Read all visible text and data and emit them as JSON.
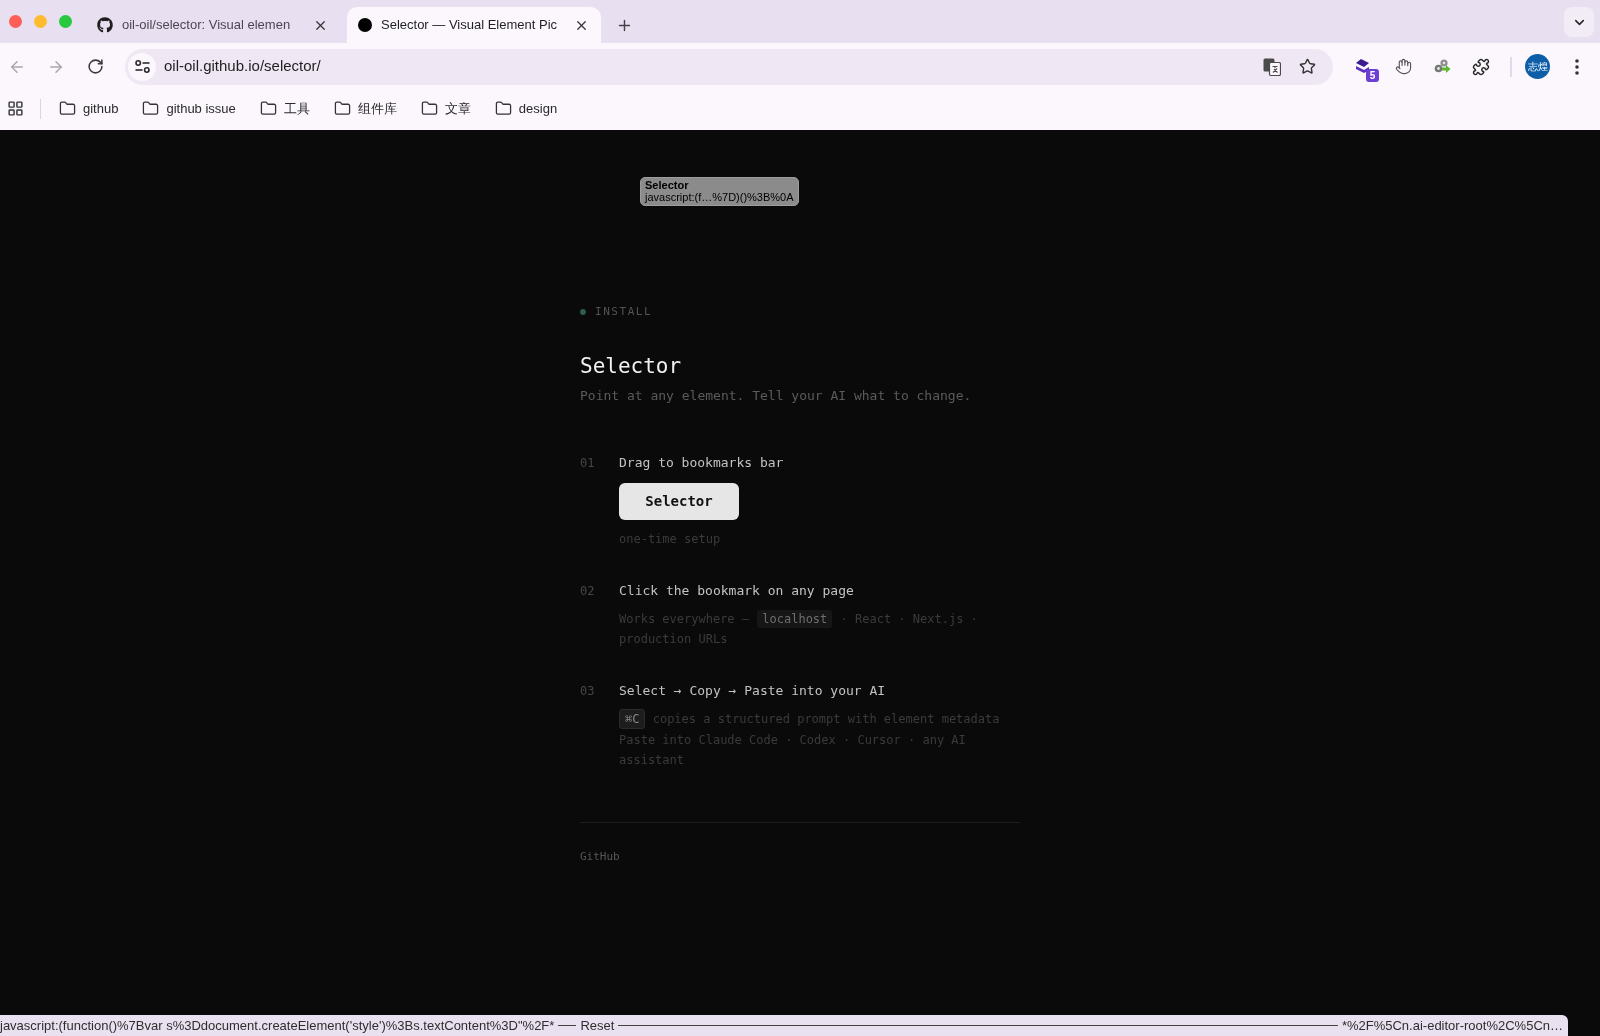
{
  "browser": {
    "tabs": [
      {
        "title": "oil-oil/selector: Visual elemen",
        "selected": false
      },
      {
        "title": "Selector — Visual Element Pic",
        "selected": true
      }
    ],
    "navigation": [
      {
        "disabled": true
      },
      {
        "disabled": true
      },
      {
        "disabled": false
      }
    ],
    "address": "oil-oil.github.io/selector/",
    "extension_badge": "5",
    "profile": "志煌",
    "bookmarks": [
      {
        "label": "github"
      },
      {
        "label": "github issue"
      },
      {
        "label": "工具"
      },
      {
        "label": "组件库"
      },
      {
        "label": "文章"
      },
      {
        "label": "design"
      }
    ]
  },
  "tooltip": {
    "title": "Selector",
    "url": "javascript:(f…%7D)()%3B%0A"
  },
  "page": {
    "eyebrow": "INSTALL",
    "title": "Selector",
    "subtitle": "Point at any element. Tell your AI what to change.",
    "steps": [
      {
        "number": "01",
        "title": "Drag to bookmarks bar",
        "blocks": [
          {
            "kind": "button",
            "label": "Selector"
          },
          {
            "kind": "note",
            "segments": [
              {
                "kind": "text",
                "text": "one-time setup"
              }
            ]
          }
        ]
      },
      {
        "number": "02",
        "title": "Click the bookmark on any page",
        "blocks": [
          {
            "kind": "note",
            "segments": [
              {
                "kind": "text",
                "text": "Works everywhere — "
              },
              {
                "kind": "code",
                "text": "localhost"
              },
              {
                "kind": "text",
                "text": " · React · Next.js · production URLs"
              }
            ]
          }
        ]
      },
      {
        "number": "03",
        "title": "Select → Copy → Paste into your AI",
        "blocks": [
          {
            "kind": "note",
            "segments": [
              {
                "kind": "kbd",
                "text": "⌘C"
              },
              {
                "kind": "text",
                "text": " copies a structured prompt with element metadata"
              }
            ]
          },
          {
            "kind": "note",
            "segments": [
              {
                "kind": "text",
                "text": "Paste into Claude Code · Codex · Cursor · any AI assistant"
              }
            ]
          }
        ]
      }
    ],
    "footer_link": "GitHub"
  },
  "status_bar": {
    "start": "javascript:(function()%7Bvar s%3Ddocument.createElement('style')%3Bs.textContent%3D\"%2F*",
    "label": "Reset",
    "end": "*%2F%5Cn.ai-editor-root%2C%5Cn…"
  }
}
